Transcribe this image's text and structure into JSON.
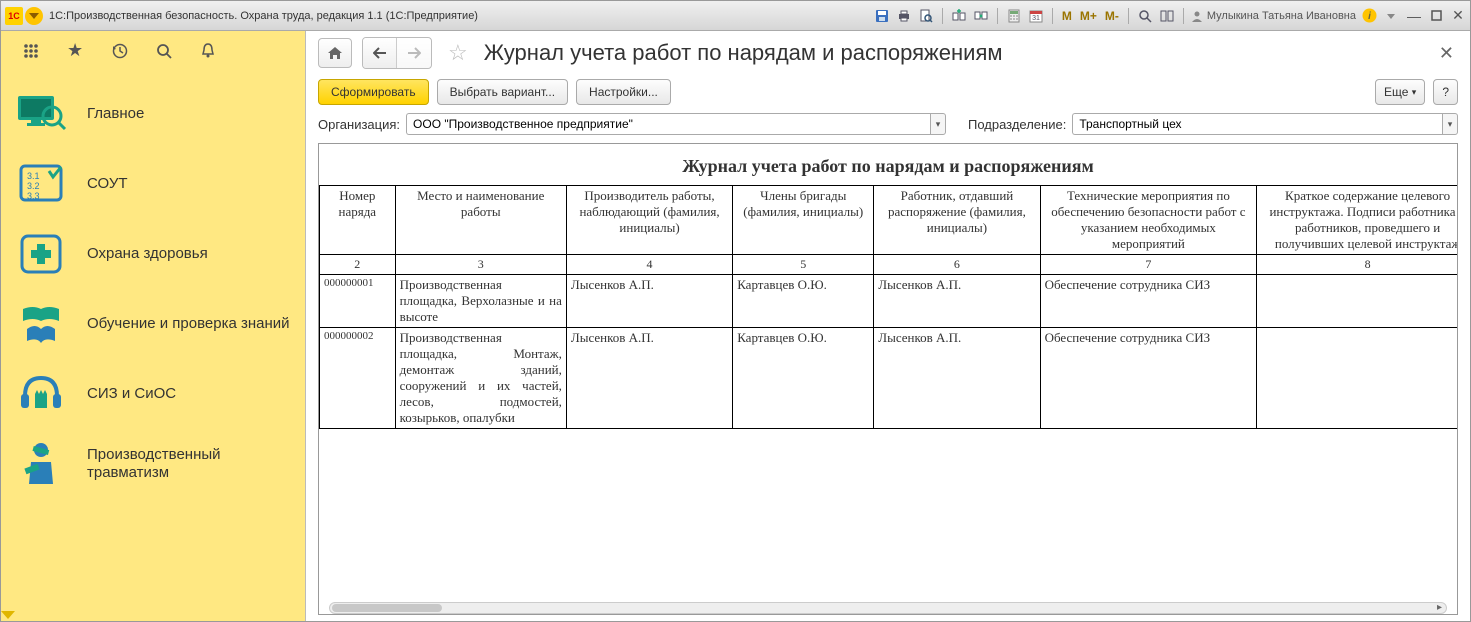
{
  "titlebar": {
    "logo_text": "1C",
    "title": "1С:Производственная безопасность. Охрана труда, редакция 1.1  (1С:Предприятие)",
    "user": "Мулыкина Татьяна Ивановна",
    "m_labels": [
      "M",
      "M+",
      "M-"
    ]
  },
  "sidebar": {
    "items": [
      {
        "label": "Главное"
      },
      {
        "label": "СОУТ"
      },
      {
        "label": "Охрана здоровья"
      },
      {
        "label": "Обучение и проверка знаний"
      },
      {
        "label": "СИЗ и СиОС"
      },
      {
        "label": "Производственный травматизм"
      }
    ]
  },
  "page": {
    "title": "Журнал учета работ по нарядам и распоряжениям",
    "close_tooltip": "Закрыть"
  },
  "actions": {
    "generate": "Сформировать",
    "choose_variant": "Выбрать вариант...",
    "settings": "Настройки...",
    "more": "Еще",
    "help": "?"
  },
  "filters": {
    "org_label": "Организация:",
    "org_value": "ООО \"Производственное предприятие\"",
    "dept_label": "Подразделение:",
    "dept_value": "Транспортный цех"
  },
  "report": {
    "title": "Журнал учета работ по нарядам и распоряжениям",
    "headers": [
      "Номер наряда",
      "Место и наименование работы",
      "Производитель работы, наблюдающий (фамилия, инициалы)",
      "Члены бригады (фамилия, инициалы)",
      "Работник, отдавший распоряжение (фамилия, инициалы)",
      "Технические мероприятия по обеспечению безопасности работ с указанием необходимых мероприятий",
      "Краткое содержание целевого инструктажа. Подписи работника и работников, проведшего и получивших целевой инструктаж"
    ],
    "col_numbers": [
      "2",
      "3",
      "4",
      "5",
      "6",
      "7",
      "8"
    ],
    "rows": [
      {
        "num": "000000001",
        "place": "Производственная площадка, Верхолазные и на высоте",
        "producer": "Лысенков А.П.",
        "members": "Картавцев О.Ю.",
        "ordered": "Лысенков А.П.",
        "measures": "Обеспечение сотрудника СИЗ",
        "brief": ""
      },
      {
        "num": "000000002",
        "place": "Производственная площадка, Монтаж, демонтаж зданий, сооружений и их частей, лесов, подмостей, козырьков, опалубки",
        "producer": "Лысенков А.П.",
        "members": "Картавцев О.Ю.",
        "ordered": "Лысенков А.П.",
        "measures": "Обеспечение сотрудника СИЗ",
        "brief": ""
      }
    ]
  }
}
